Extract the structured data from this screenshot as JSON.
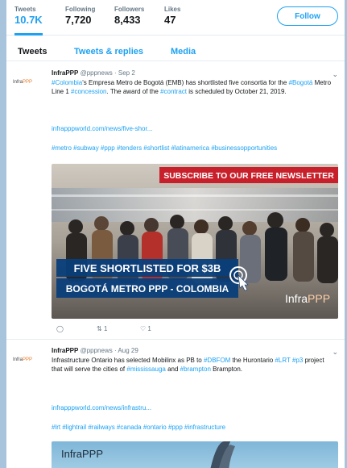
{
  "stats": [
    {
      "label": "Tweets",
      "value": "10.7K"
    },
    {
      "label": "Following",
      "value": "7,720"
    },
    {
      "label": "Followers",
      "value": "8,433"
    },
    {
      "label": "Likes",
      "value": "47"
    }
  ],
  "follow_label": "Follow",
  "tabs": [
    "Tweets",
    "Tweets & replies",
    "Media"
  ],
  "tweets": [
    {
      "logo": "Infra",
      "logo_ppp": "PPP",
      "name": "InfraPPP",
      "handle": "@pppnews",
      "date": "· Sep 2",
      "text_parts": {
        "p1": "#Colombia",
        "p2": "'s Empresa Metro de Bogotá (EMB) has shortlisted five consortia for the ",
        "p3": "#Bogotá",
        "p4": " Metro Line 1 ",
        "p5": "#concession",
        "p6": ". The award of the ",
        "p7": "#contract",
        "p8": " is scheduled by October 21, 2019."
      },
      "link": "infrapppworld.com/news/five-shor...",
      "hashtags": "#metro #subway #ppp #tenders #shortlist #latinamerica #businessopportunities",
      "media": {
        "banner": "SUBSCRIBE TO OUR FREE NEWSLETTER",
        "headline1": "FIVE SHORTLISTED FOR $3B",
        "headline2": "BOGOTÁ METRO PPP - COLOMBIA",
        "brand": "Infra",
        "brand_ppp": "PPP"
      },
      "retweets": "1",
      "likes": "1"
    },
    {
      "logo": "Infra",
      "logo_ppp": "PPP",
      "name": "InfraPPP",
      "handle": "@pppnews",
      "date": "· Aug 29",
      "text_parts": {
        "p1": "Infrastructure Ontario has selected Mobilinx as PB to ",
        "p2": "#DBFOM",
        "p3": " the Hurontario ",
        "p4": "#LRT",
        "p5": " ",
        "p6": "#p3",
        "p7": " project that will serve the cities of ",
        "p8": "#mississauga",
        "p9": " and ",
        "p10": "#brampton",
        "p11": " Brampton."
      },
      "link": "infrapppworld.com/news/infrastru...",
      "hashtags": "#lrt #lightrail #railways #canada #ontario #ppp #infrastructure",
      "media": {
        "brand": "Infra",
        "brand_ppp": "PPP"
      }
    }
  ],
  "colors": {
    "accent": "#1da1f2",
    "text": "#14171a",
    "muted": "#657786",
    "banner_red": "#c8202b",
    "headline_bg": "#0a3e7a",
    "page_bg": "#a8c4dc"
  },
  "icons": [
    "chevron-down-icon",
    "reply-icon",
    "retweet-icon",
    "like-icon",
    "cursor-icon"
  ]
}
